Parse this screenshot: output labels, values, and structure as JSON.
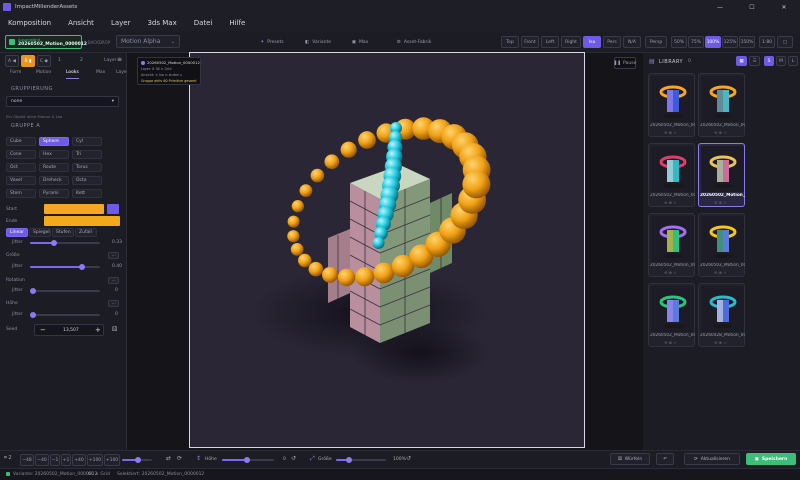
{
  "window": {
    "title": "ImpactMillenderAssets",
    "controls": [
      "—",
      "☐",
      "✕"
    ]
  },
  "menu": [
    "Komposition",
    "Ansicht",
    "Layer",
    "3ds Max",
    "Datei",
    "Hilfe"
  ],
  "toolbar": {
    "project_status": "Ausgewählt",
    "project_name": "20260502_Motion_0000012",
    "mode_buttons": [
      "A ◀",
      "B ▮",
      "C ◆"
    ],
    "nav_labels": [
      "1",
      "2",
      "Layer"
    ],
    "background_label": "BACKDROP",
    "background_select": "Motion Alpha",
    "center_tabs": [
      "Presets",
      "Variante",
      "Max",
      "Asset-Fabrik"
    ],
    "view_buttons": [
      "Top",
      "Front",
      "Left",
      "Right",
      "Iso",
      "Pers",
      "N/A",
      "Persp"
    ],
    "active_view": "Iso",
    "zoom_buttons": [
      "50%",
      "75%",
      "100%",
      "125%",
      "150%"
    ],
    "active_zoom": "100%",
    "extra_buttons": [
      "1:80",
      "□"
    ]
  },
  "left_panel": {
    "subtabs": [
      "A ◀",
      "B ▮",
      "C ◆",
      "1",
      "2",
      "Layer"
    ],
    "tabs": [
      "Form",
      "Motion",
      "Looks",
      "Max",
      "Layer"
    ],
    "active_tab": "Looks",
    "grouping_label": "GRUPPIERUNG",
    "grouping_value": "none",
    "grouping_hint": "Ein Objekt ohne Motion & Loo",
    "group_label": "GRUPPE A",
    "shapes": [
      "Cube",
      "Sphere",
      "Cyl",
      "Cone",
      "Hex",
      "Tri",
      "Oct",
      "Route",
      "Torus",
      "Voxel",
      "Dreheck",
      "Octa",
      "Stern",
      "Pyrami",
      "Kett"
    ],
    "active_shape": "Sphere",
    "start_label": "Start",
    "end_label": "Ende",
    "gradient_modes": [
      "Linear",
      "Spiegel",
      "Stufen",
      "Zufall"
    ],
    "active_gradient": "Linear",
    "sliders": [
      {
        "label": "Jitter",
        "sub": "",
        "value": "0.33",
        "fill": 0.33
      },
      {
        "label": "Größe",
        "sub": "Jitter",
        "value": "0.40",
        "fill": 0.88
      },
      {
        "label": "Rotation",
        "sub": "Jitter",
        "value": "0",
        "fill": 0
      },
      {
        "label": "Höhe",
        "sub": "Jitter",
        "value": "0",
        "fill": 0
      }
    ],
    "seed_label": "Seed",
    "seed_value": "13,507",
    "seed_minus": "−",
    "seed_plus": "+"
  },
  "viewport": {
    "info_title": "20260502_Motion_0000012",
    "info_lines": [
      "Layer: 8   36 × Grid",
      "Ansicht: ± Iso   ⊙ stufen s",
      "Gruppe aktiv   60 Primitive gesamt"
    ],
    "pause_label": "Pause"
  },
  "library": {
    "title": "LIBRARY",
    "count": "0",
    "cards": [
      {
        "name": "20260502_Motion_00",
        "selected": false
      },
      {
        "name": "20260502_Motion_00",
        "selected": false
      },
      {
        "name": "20260502_Motion_00",
        "selected": false
      },
      {
        "name": "20260502_Motion_0",
        "selected": true
      },
      {
        "name": "20260502_Motion_00",
        "selected": false
      },
      {
        "name": "20260502_Motion_00",
        "selected": false
      },
      {
        "name": "20260502_Motion_00",
        "selected": false
      },
      {
        "name": "20260428_Motion_00",
        "selected": false
      }
    ],
    "view_options": [
      "S",
      "M",
      "L"
    ]
  },
  "bottom": {
    "frame_buttons": [
      "−48",
      "−40",
      "−1",
      "+1",
      "+40",
      "+100",
      "+100"
    ],
    "hoehe_label": "Höhe",
    "hoehe_value": "0",
    "groesse_label": "Größe",
    "groesse_value": "100%",
    "wuerfeln": "Würfeln",
    "aktualisieren": "Aktualisieren",
    "speichern": "Speichern"
  },
  "statusbar": {
    "variante_label": "Variante: 20260502_Motion_0000012",
    "count": "60 × Grid",
    "selection": "Selektiert: 20260502_Motion_0000012"
  },
  "colors": {
    "accent": "#6e5ae6",
    "start_color": "#f5a623",
    "end_color": "#f3a91c",
    "save_green": "#3dbd79"
  }
}
